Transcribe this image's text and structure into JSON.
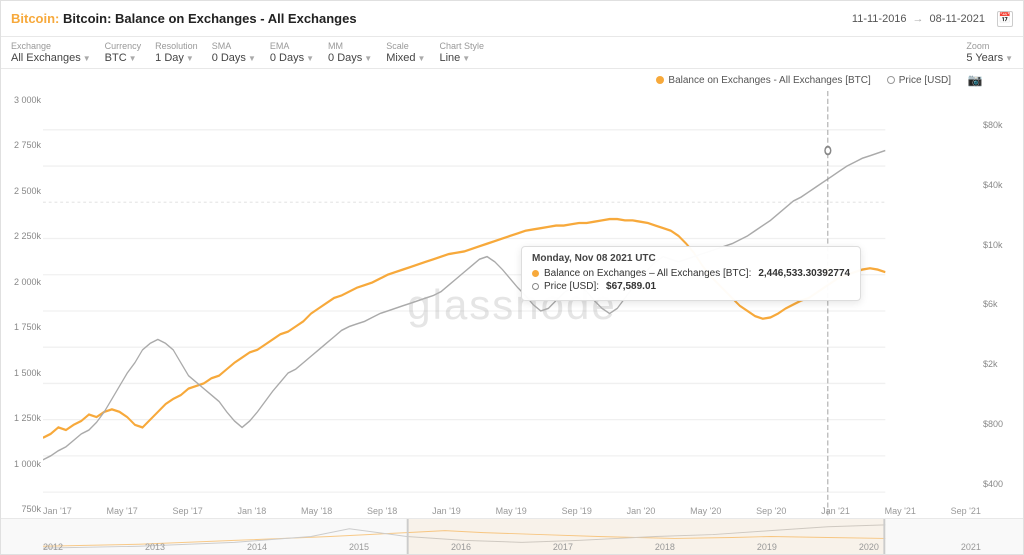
{
  "header": {
    "title": "Bitcoin: Balance on Exchanges - All Exchanges",
    "bitcoin_prefix": "Bitcoin:",
    "date_start": "11-11-2016",
    "date_end": "08-11-2021"
  },
  "controls": {
    "exchange_label": "Exchange",
    "exchange_value": "All Exchanges",
    "currency_label": "Currency",
    "currency_value": "BTC",
    "resolution_label": "Resolution",
    "resolution_value": "1 Day",
    "sma_label": "SMA",
    "sma_value": "0 Days",
    "ema_label": "EMA",
    "ema_value": "0 Days",
    "mm_label": "MM",
    "mm_value": "0 Days",
    "scale_label": "Scale",
    "scale_value": "Mixed",
    "chart_style_label": "Chart Style",
    "chart_style_value": "Line",
    "zoom_label": "Zoom",
    "zoom_value": "5 Years"
  },
  "legend": {
    "orange_label": "Balance on Exchanges - All Exchanges [BTC]",
    "gray_label": "Price [USD]"
  },
  "tooltip": {
    "date": "Monday, Nov 08 2021 UTC",
    "btc_label": "Balance on Exchanges – All Exchanges [BTC]:",
    "btc_value": "2,446,533.30392774",
    "price_label": "Price [USD]:",
    "price_value": "$67,589.01"
  },
  "y_axis_left": {
    "labels": [
      "3 000k",
      "2 750k",
      "2 500k",
      "2 250k",
      "2 000k",
      "1 750k",
      "1 500k",
      "1 250k",
      "1 000k",
      "750k"
    ]
  },
  "y_axis_right": {
    "labels": [
      "$80k",
      "$40k",
      "$10k",
      "$6k",
      "$2k",
      "$800",
      "$400"
    ]
  },
  "x_axis": {
    "labels": [
      "Jan '17",
      "May '17",
      "Sep '17",
      "Jan '18",
      "May '18",
      "Sep '18",
      "Jan '19",
      "May '19",
      "Sep '19",
      "Jan '20",
      "May '20",
      "Sep '20",
      "Jan '21",
      "May '21",
      "Sep '21"
    ]
  },
  "minimap": {
    "labels": [
      "2012",
      "2013",
      "2014",
      "2015",
      "2016",
      "2017",
      "2018",
      "2019",
      "2020",
      "2021"
    ]
  },
  "watermark": "glassnode"
}
